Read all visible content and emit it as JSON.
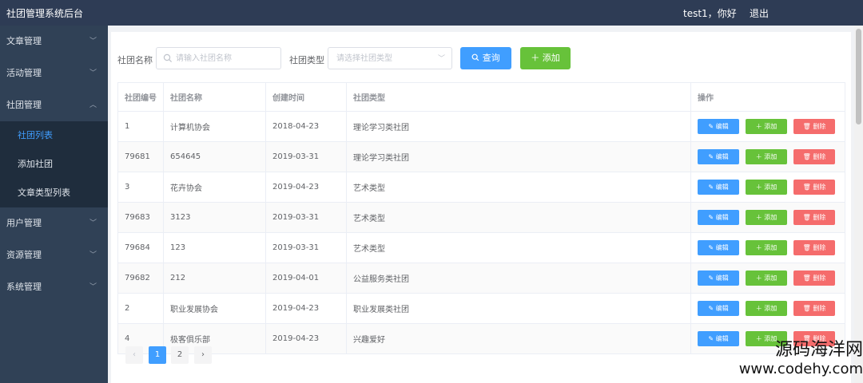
{
  "app": {
    "title": "社团管理系统后台",
    "greeting": "test1，你好",
    "logout": "退出"
  },
  "sidebar": {
    "items": [
      {
        "label": "文章管理"
      },
      {
        "label": "活动管理"
      },
      {
        "label": "社团管理"
      },
      {
        "label": "用户管理"
      },
      {
        "label": "资源管理"
      },
      {
        "label": "系统管理"
      }
    ],
    "submenu": [
      {
        "label": "社团列表"
      },
      {
        "label": "添加社团"
      },
      {
        "label": "文章类型列表"
      }
    ]
  },
  "filters": {
    "name_label": "社团名称",
    "name_placeholder": "请输入社团名称",
    "type_label": "社团类型",
    "type_placeholder": "请选择社团类型",
    "search_label": "查询",
    "add_label": "添加"
  },
  "table": {
    "columns": [
      "社团编号",
      "社团名称",
      "创建时间",
      "社团类型",
      "操作"
    ],
    "rows": [
      {
        "id": "1",
        "name": "计算机协会",
        "date": "2018-04-23",
        "type": "理论学习类社团"
      },
      {
        "id": "79681",
        "name": "654645",
        "date": "2019-03-31",
        "type": "理论学习类社团"
      },
      {
        "id": "3",
        "name": "花卉协会",
        "date": "2019-04-23",
        "type": "艺术类型"
      },
      {
        "id": "79683",
        "name": "3123",
        "date": "2019-03-31",
        "type": "艺术类型"
      },
      {
        "id": "79684",
        "name": "123",
        "date": "2019-03-31",
        "type": "艺术类型"
      },
      {
        "id": "79682",
        "name": "212",
        "date": "2019-04-01",
        "type": "公益服务类社团"
      },
      {
        "id": "2",
        "name": "职业发展协会",
        "date": "2019-04-23",
        "type": "职业发展类社团"
      },
      {
        "id": "4",
        "name": "极客俱乐部",
        "date": "2019-04-23",
        "type": "兴趣爱好"
      }
    ],
    "ops": {
      "edit": "编辑",
      "add": "添加",
      "delete": "删除"
    }
  },
  "pagination": {
    "prev": "‹",
    "pages": [
      "1",
      "2"
    ],
    "next": "›",
    "current": "1"
  },
  "watermark": {
    "name": "源码海洋网",
    "url": "www.codehy.com"
  },
  "colors": {
    "primary": "#409eff",
    "success": "#67c23a",
    "danger": "#f56c6c",
    "topbar": "#2e3c55",
    "sidebar": "#304156"
  }
}
